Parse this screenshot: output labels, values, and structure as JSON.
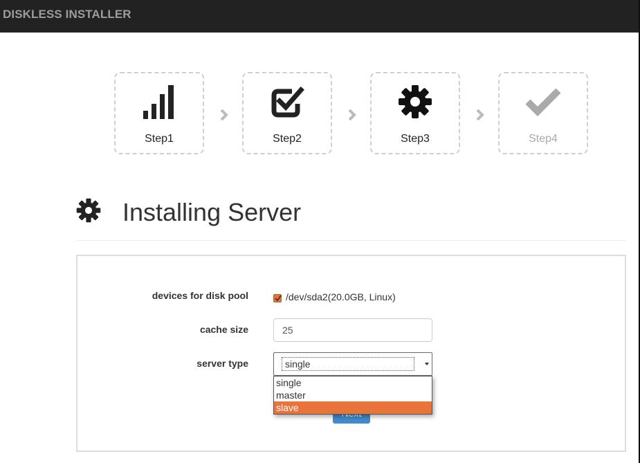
{
  "app": {
    "title": "DISKLESS INSTALLER"
  },
  "steps": [
    {
      "label": "Step1",
      "icon": "signal-bars-icon",
      "state": "done"
    },
    {
      "label": "Step2",
      "icon": "check-square-icon",
      "state": "done"
    },
    {
      "label": "Step3",
      "icon": "gear-icon",
      "state": "active"
    },
    {
      "label": "Step4",
      "icon": "checkmark-icon",
      "state": "disabled"
    }
  ],
  "header": {
    "title": "Installing Server",
    "icon": "gear-icon"
  },
  "form": {
    "disk_pool": {
      "label": "devices for disk pool",
      "device": "/dev/sda2(20.0GB, Linux)",
      "checked": true
    },
    "cache_size": {
      "label": "cache size",
      "value": "25"
    },
    "server_type": {
      "label": "server type",
      "selected": "single",
      "options": [
        "single",
        "master",
        "slave"
      ],
      "highlighted": "slave"
    },
    "next_button": {
      "label": "Next"
    }
  },
  "colors": {
    "navbar": "#222222",
    "accent": "#e8743b",
    "primary": "#428bca"
  }
}
